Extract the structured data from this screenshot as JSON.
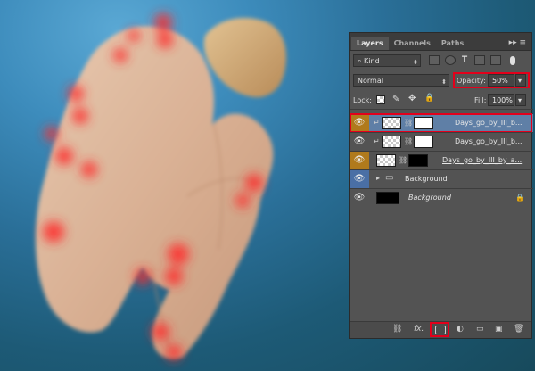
{
  "panel": {
    "tabs": [
      {
        "label": "Layers"
      },
      {
        "label": "Channels"
      },
      {
        "label": "Paths"
      }
    ],
    "menu_glyph": "▸▸ ≡",
    "filter": {
      "kind_label": "Kind",
      "icon": "search-icon"
    },
    "blend_mode": "Normal",
    "opacity_label": "Opacity:",
    "opacity_value": "50%",
    "lock_label": "Lock:",
    "fill_label": "Fill:",
    "fill_value": "100%",
    "layers": [
      {
        "name": "Days_go_by_III_b...",
        "selected": true,
        "clipped": true,
        "eye_bg": "#b07a1c"
      },
      {
        "name": "Days_go_by_III_b...",
        "selected": false,
        "clipped": true,
        "eye_bg": ""
      },
      {
        "name": "Days_go_by_III_by_a...",
        "selected": false,
        "clipped": false,
        "eye_bg": "#b07a1c"
      },
      {
        "name": "Background",
        "selected": false,
        "group": true,
        "eye_bg": "#4a6fa5"
      },
      {
        "name": "Background",
        "selected": false,
        "locked": true,
        "eye_bg": ""
      }
    ],
    "bottom_icons": [
      "link-icon",
      "fx-icon",
      "add-mask-icon",
      "adjustment-icon",
      "folder-icon",
      "new-layer-icon",
      "trash-icon"
    ],
    "fx_label": "fx."
  },
  "colors": {
    "highlight": "#e3001b",
    "selected_row": "#5f7fa6",
    "accent_orange": "#b07a1c"
  }
}
